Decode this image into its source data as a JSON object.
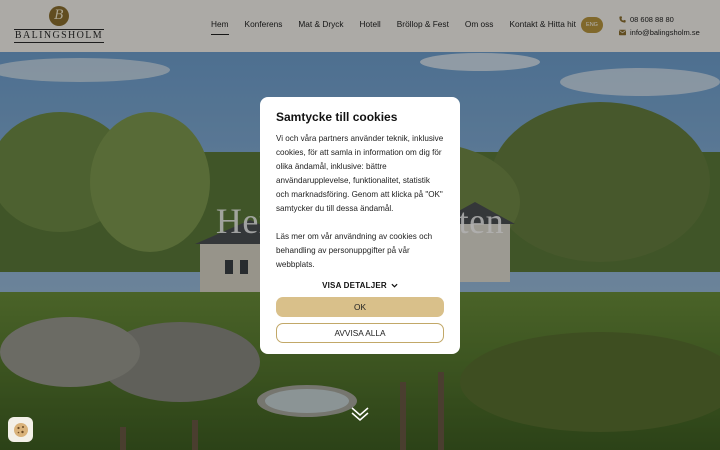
{
  "header": {
    "logo_text": "BALINGSHOLM",
    "logo_mark": "B",
    "nav": [
      "Hem",
      "Konferens",
      "Mat & Dryck",
      "Hotell",
      "Bröllop & Fest",
      "Om oss",
      "Kontakt & Hitta hit"
    ],
    "active_nav": "Hem",
    "lang_label": "ENG",
    "phone": "08 608 88 80",
    "email": "info@balingsholm.se"
  },
  "hero": {
    "title": "Herrgård för möten"
  },
  "cookie_modal": {
    "title": "Samtycke till cookies",
    "paragraph1": "Vi och våra partners använder teknik, inklusive cookies, för att samla in information om dig för olika ändamål, inklusive: bättre användarupplevelse, funktionalitet, statistik och marknadsföring. Genom att klicka på \"OK\" samtycker du till dessa ändamål.",
    "paragraph2": "Läs mer om vår användning av cookies och behandling av personuppgifter på vår webbplats.",
    "details_label": "VISA DETALJER",
    "ok_label": "OK",
    "reject_label": "AVVISA ALLA"
  },
  "colors": {
    "accent_gold": "#d9c08a",
    "lang_badge": "#b8963e",
    "header_bg": "#f6f4ee"
  },
  "icons": {
    "phone": "phone-icon",
    "email": "envelope-icon",
    "details": "chevron-down-icon",
    "scroll": "double-chevron-down-icon",
    "cookie": "cookie-icon"
  }
}
